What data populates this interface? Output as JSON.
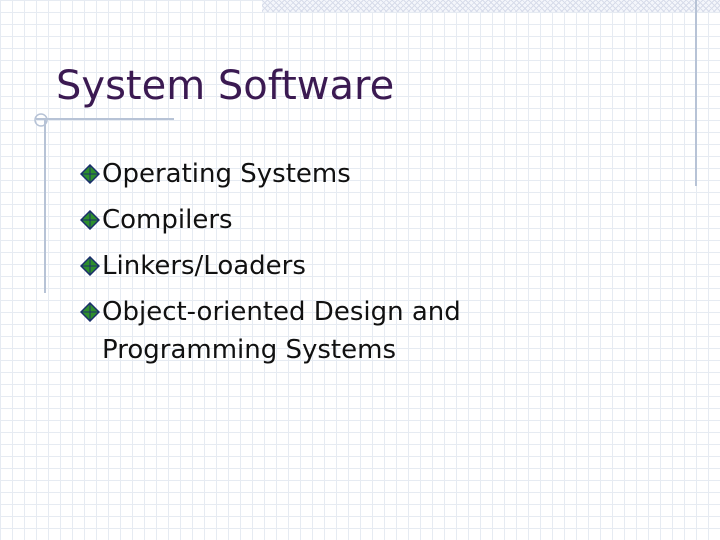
{
  "slide": {
    "title": "System Software",
    "bullets": [
      {
        "text": "Operating Systems",
        "icon": "diamond-bullet-icon"
      },
      {
        "text": "Compilers",
        "icon": "diamond-bullet-icon"
      },
      {
        "text": "Linkers/Loaders",
        "icon": "diamond-bullet-icon"
      },
      {
        "text": "Object-oriented Design and Programming Systems",
        "icon": "diamond-bullet-icon"
      }
    ]
  },
  "colors": {
    "title": "#3b1a52",
    "body_text": "#111111",
    "grid": "#e6ebf2",
    "rule": "#b7c3d6",
    "bullet_fill": "#2d8f2d",
    "bullet_stroke": "#1a2f6b"
  }
}
